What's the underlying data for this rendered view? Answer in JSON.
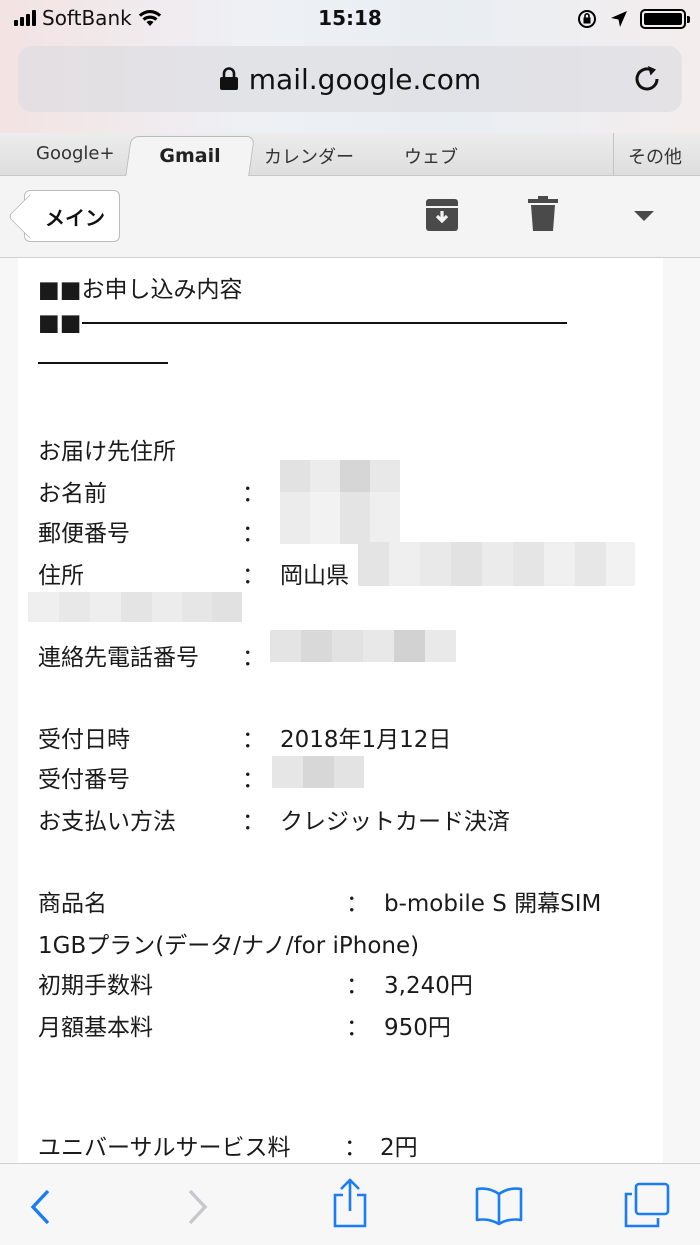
{
  "status": {
    "carrier": "SoftBank",
    "time": "15:18"
  },
  "browser": {
    "url": "mail.google.com"
  },
  "tabs": {
    "google_plus": "Google+",
    "gmail": "Gmail",
    "calendar": "カレンダー",
    "web": "ウェブ",
    "more": "その他"
  },
  "actions": {
    "back_label": "メイン"
  },
  "mail": {
    "section_header": "■■お申し込み内容",
    "rule_prefix": "■■",
    "delivery_header": "お届け先住所",
    "name_label": "お名前",
    "postal_label": "郵便番号",
    "address_label": "住所",
    "address_value": "岡山県",
    "phone_label": "連絡先電話番号",
    "date_label": "受付日時",
    "date_value": "2018年1月12日",
    "receipt_label": "受付番号",
    "payment_label": "お支払い方法",
    "payment_value": "クレジットカード決済",
    "product_label": "商品名",
    "product_value": "b-mobile S 開幕SIM",
    "product_value_cont": "1GBプラン(データ/ナノ/for iPhone)",
    "initial_fee_label": "初期手数料",
    "initial_fee_value": "3,240円",
    "monthly_fee_label": "月額基本料",
    "monthly_fee_value": "950円",
    "universal_fee_label": "ユニバーサルサービス料",
    "universal_fee_value": "2円",
    "colon": "："
  },
  "colors": {
    "accent": "#1a7cf6",
    "icon_gray": "#4a4a4a",
    "disabled_gray": "#c7c7cc"
  }
}
